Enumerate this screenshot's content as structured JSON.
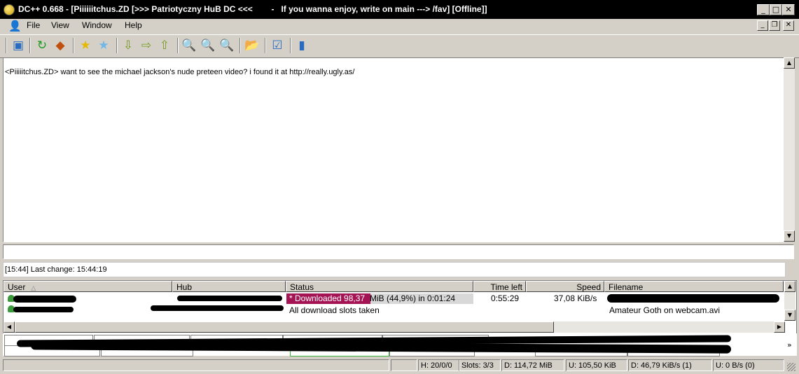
{
  "window": {
    "title": "DC++ 0.668 - [Piiiiiitchus.ZD [>>> Patriotyczny HuB DC <<<        -   If you wanna enjoy, write on main ---> /fav] [Offline]]"
  },
  "menu": {
    "file": "File",
    "view": "View",
    "window": "Window",
    "help": "Help"
  },
  "chat": {
    "message": "<Piiiiitchus.ZD> want to see the michael jackson's nude preteen video? i found it at http://really.ugly.as/"
  },
  "input": {
    "value": ""
  },
  "status_line": "[15:44] Last change: 15:44:19",
  "transfers": {
    "columns": [
      "User",
      "Hub",
      "Status",
      "Time left",
      "Speed",
      "Filename"
    ],
    "rows": [
      {
        "status_highlight": "* Downloaded 98,37",
        "status_rest": " MiB (44,9%) in 0:01:24",
        "progress": 0.449,
        "time_left": "0:55:29",
        "speed": "37,08 KiB/s"
      },
      {
        "status": "All download slots taken",
        "filename": "Amateur Goth on webcam.avi"
      }
    ]
  },
  "statusbar": {
    "hubs": "H: 20/0/0",
    "slots": "Slots: 3/3",
    "downloaded": "D: 114,72 MiB",
    "uploaded": "U: 105,50 KiB",
    "down_speed": "D: 46,79 KiB/s (1)",
    "up_speed": "U: 0 B/s (0)"
  },
  "colors": {
    "progress": "#a41454",
    "titlebar": "#000000",
    "chrome": "#d4d0c8"
  }
}
